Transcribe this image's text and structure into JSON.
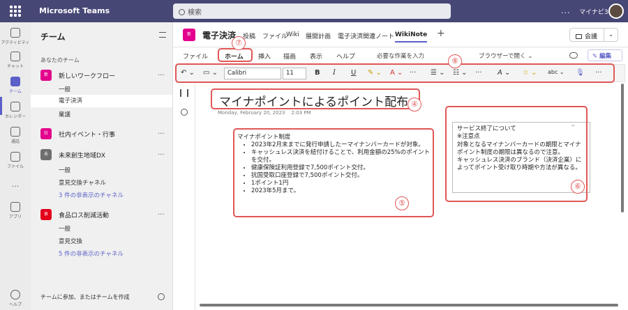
{
  "app": {
    "title": "Microsoft Teams",
    "tenant": "マイナビ365",
    "more": "..."
  },
  "search": {
    "placeholder": "検索"
  },
  "rail": [
    {
      "label": "アクティビティ",
      "icon": "bell-icon"
    },
    {
      "label": "チャット",
      "icon": "chat-icon"
    },
    {
      "label": "チーム",
      "icon": "teams-icon"
    },
    {
      "label": "カレンダー",
      "icon": "calendar-icon"
    },
    {
      "label": "通話",
      "icon": "phone-icon"
    },
    {
      "label": "ファイル",
      "icon": "file-icon"
    },
    {
      "label": "...",
      "icon": "more-icon"
    },
    {
      "label": "アプリ",
      "icon": "apps-icon"
    },
    {
      "label": "ヘルプ",
      "icon": "help-icon"
    }
  ],
  "teams_panel": {
    "title": "チーム",
    "your_teams": "あなたのチーム",
    "teams": [
      {
        "initial": "新",
        "name": "新しいワークフロー",
        "color": "#e3008c"
      },
      {
        "initial": "社",
        "name": "社内イベント・行事",
        "color": "#e3008c"
      },
      {
        "initial": "未",
        "name": "未来創生地域DX",
        "color": "#6e6e6e"
      },
      {
        "initial": "食",
        "name": "食品ロス削減活動",
        "color": "#e3001b"
      }
    ],
    "channels": {
      "t1": [
        "一般",
        "電子決済",
        "稟議"
      ],
      "t3": [
        "一般",
        "意見交換チャネル",
        "3 件の非表示のチャネル"
      ],
      "t4": [
        "一般",
        "意見交換",
        "5 件の非表示のチャネル"
      ]
    },
    "more": "...",
    "join": "チームに参加、またはチームを作成"
  },
  "channel": {
    "icon_initial": "新",
    "name": "電子決済",
    "tabs": [
      "投稿",
      "ファイル",
      "Wiki",
      "展開計画",
      "電子決済関連ノート",
      "WikiNote"
    ],
    "plus": "+",
    "meet": "会議"
  },
  "ribbon": {
    "tabs": [
      "ファイル",
      "ホーム",
      "挿入",
      "描画",
      "表示",
      "ヘルプ"
    ],
    "hint": "必要な作業を入力",
    "browser": "ブラウザーで開く ⌄",
    "edit": "✎ 編集 ⌄"
  },
  "toolbar": {
    "undo": "↶ ⌄",
    "clipboard": "▭ ⌄",
    "font": "Calibri",
    "size": "11",
    "bold": "B",
    "italic": "I",
    "underline": "U",
    "highlight": "✎ ⌄",
    "fontcolor": "A ⌄",
    "more1": "···",
    "bullets": "☰ ⌄",
    "numbering": "☷ ⌄",
    "more2": "···",
    "styles": "A ⌄",
    "tags": "☆ ⌄",
    "spell": "abc ⌄",
    "dictate": "🎙",
    "more3": "···"
  },
  "page": {
    "title": "マイナポイントによるポイント配布",
    "date": "Monday, February 20, 2023",
    "time": "2:03 PM",
    "block1": {
      "heading": "マイナポイント制度",
      "items": [
        "2023年2月末までに発行申請したーマイナンバーカードが対象。",
        "キャッシュレス決済を紐付けることで、利用金額の25%のポイントを交付。",
        "健康保険証利用登録で7,500ポイント交付。",
        "抗国受取口座登録で7,500ポイント交付。",
        "1ポイント1円",
        "2023年5月まで。"
      ]
    },
    "block2": {
      "handle": "‹›",
      "lines": [
        "サービス終了について",
        "※注意点",
        "対象となるマイナンバーカードの期限とマイナポイント制度の期限は異なるので注意。",
        "キャッシュレス決済のブランド（決済企業）によってポイント受け取り時期や方法が異なる。"
      ]
    }
  },
  "annotations": {
    "n7": "⑦",
    "n8": "⑧",
    "n4": "④",
    "n5": "⑤",
    "n6": "⑥"
  },
  "colors": {
    "brand": "#464775",
    "accent": "#5b5fc7",
    "annotation": "#e05656"
  }
}
